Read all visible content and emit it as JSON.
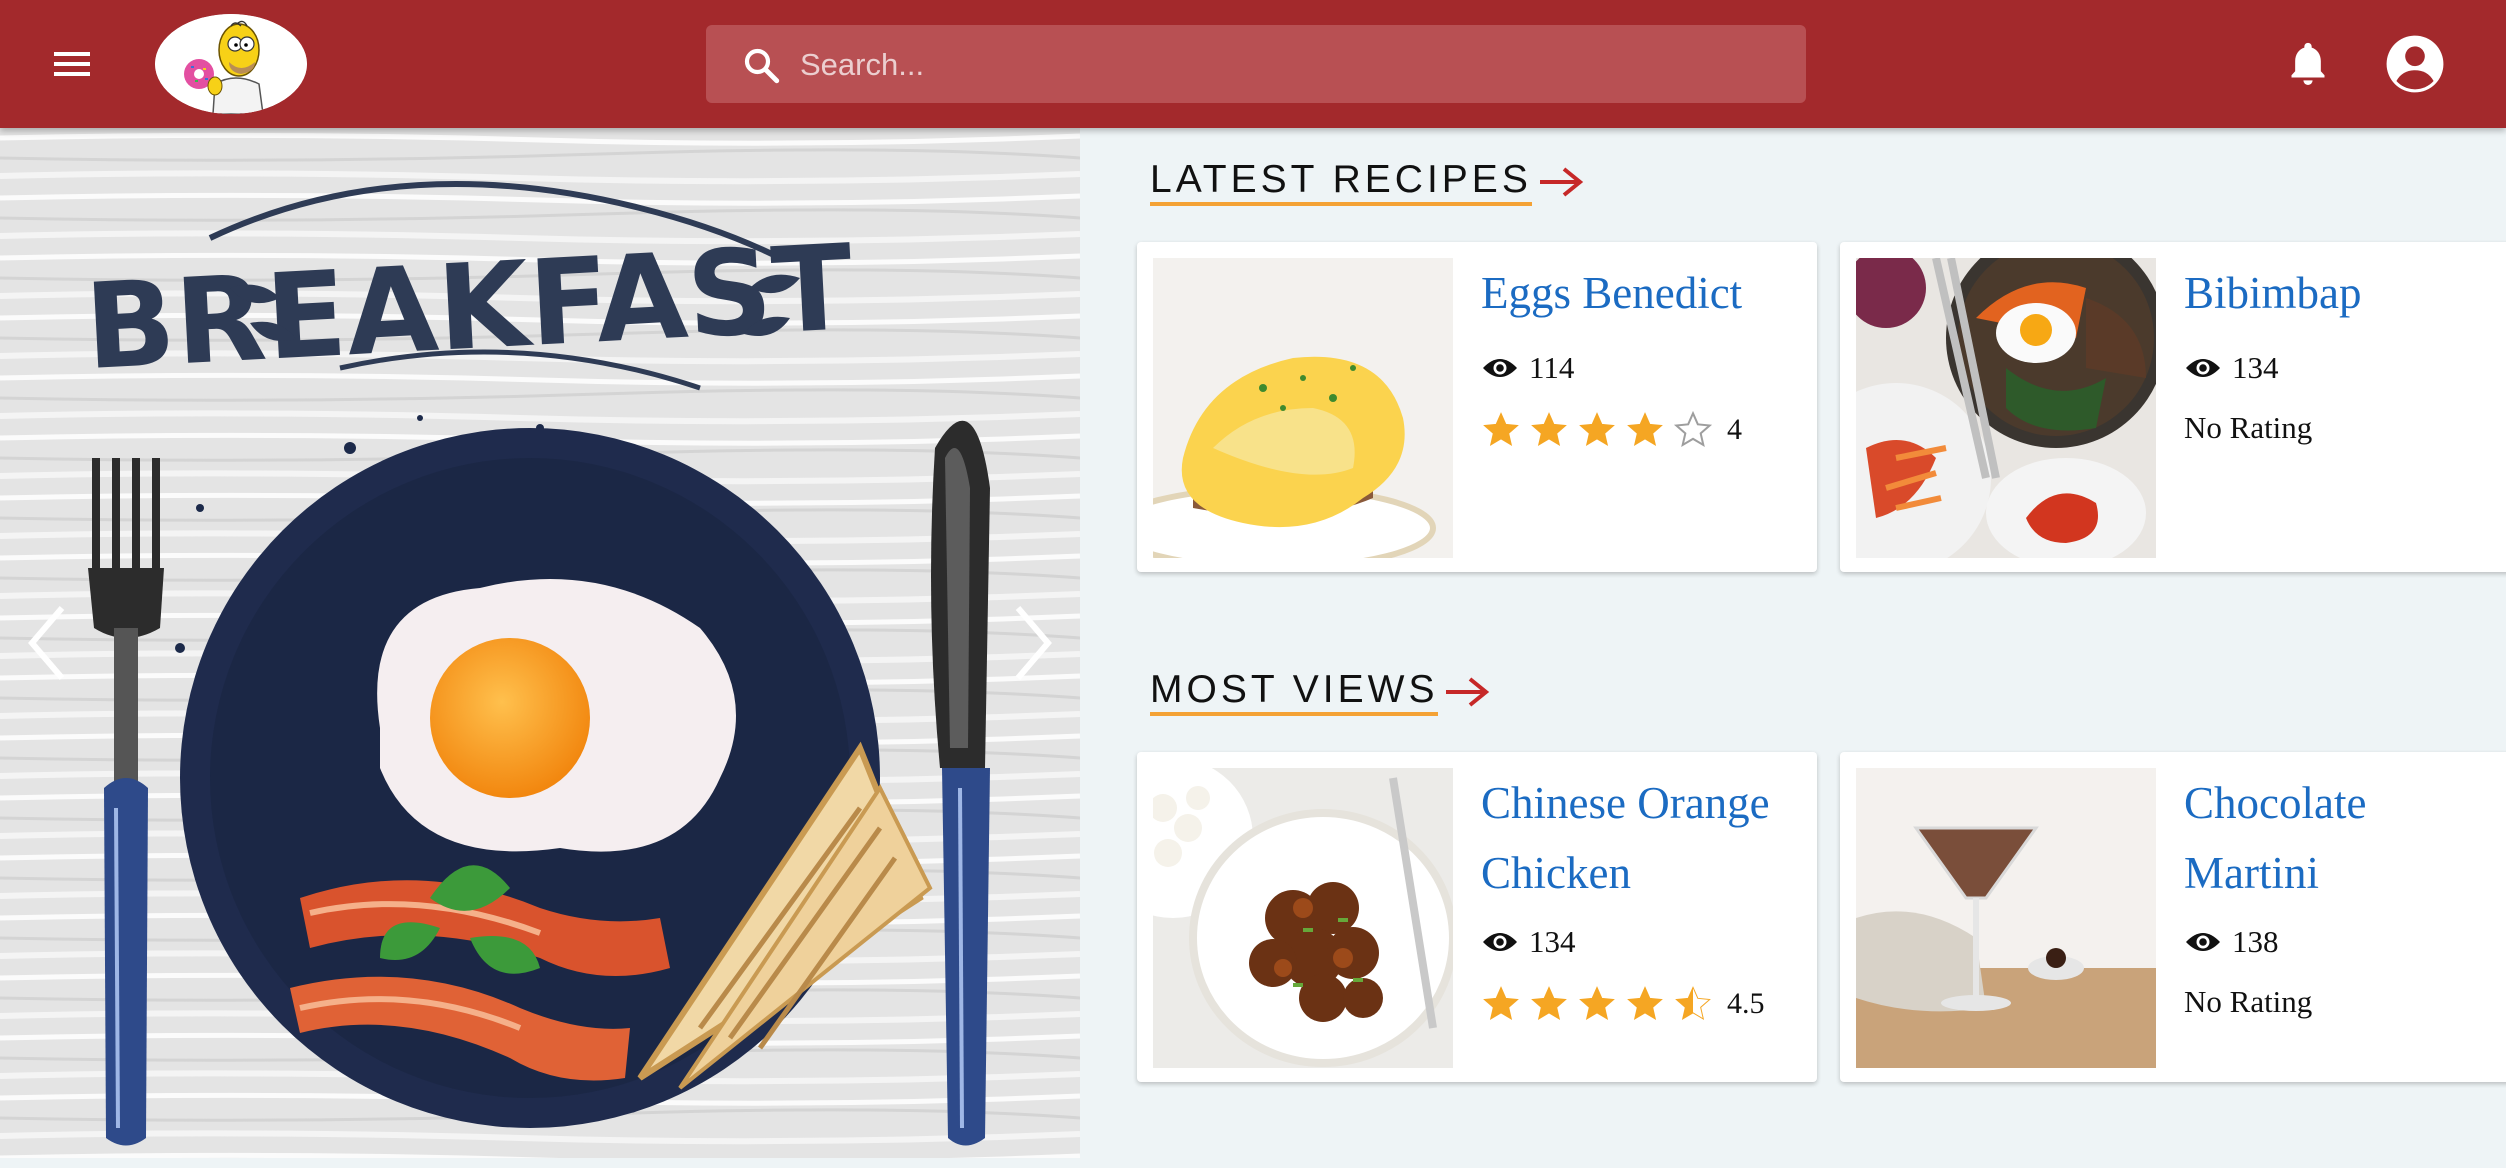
{
  "search": {
    "placeholder": "Search..."
  },
  "carousel": {
    "caption": "BREAKFAST"
  },
  "sections": [
    {
      "title": "LATEST RECIPES",
      "cards": [
        {
          "name": "Eggs Benedict",
          "views": "114",
          "rating": 4,
          "rating_label": "4",
          "no_rating": ""
        },
        {
          "name": "Bibimbap",
          "views": "134",
          "rating": null,
          "rating_label": "",
          "no_rating": "No Rating"
        }
      ]
    },
    {
      "title": "MOST VIEWS",
      "cards": [
        {
          "name": "Chinese Orange Chicken",
          "views": "134",
          "rating": 4.5,
          "rating_label": "4.5",
          "no_rating": ""
        },
        {
          "name": "Chocolate Martini",
          "views": "138",
          "rating": null,
          "rating_label": "",
          "no_rating": "No Rating"
        }
      ]
    }
  ],
  "colors": {
    "header": "#a3292c",
    "accent_link": "#1b6bc2",
    "star": "#f5a623",
    "underline": "#f4a235",
    "arrow": "#c62828"
  },
  "icons": {
    "menu": "menu-icon",
    "search": "search-icon",
    "bell": "bell-icon",
    "account": "account-circle-icon",
    "views": "eye-icon",
    "rating": "star-icon"
  }
}
